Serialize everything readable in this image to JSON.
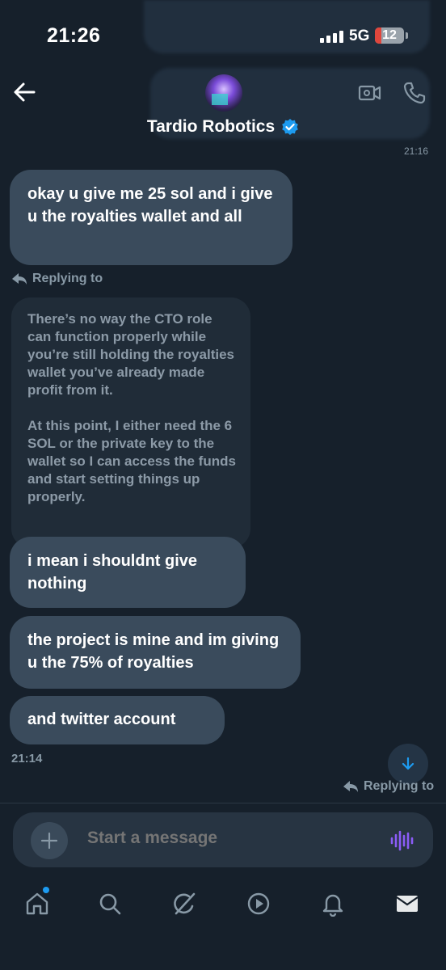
{
  "status_bar": {
    "time": "21:26",
    "network": "5G",
    "battery": "12"
  },
  "header": {
    "name": "Tardio Robotics",
    "partial_time": "21:16"
  },
  "messages": [
    {
      "text": "okay u give me  25 sol and i give u the royalties wallet and all"
    },
    {
      "text": "i mean i shouldnt give nothing"
    },
    {
      "text": "the project is mine and im giving u the 75% of royalties"
    },
    {
      "text": "and twitter account"
    }
  ],
  "reply": {
    "label": "Replying to",
    "quote": "There’s no way the CTO role can function properly while you’re still holding the royalties wallet you’ve already made profit from it.\n\nAt this point, I either need the 6 SOL or the private key to the wallet so I can access the funds and start setting things up properly."
  },
  "timestamp": "21:14",
  "composer": {
    "placeholder": "Start a message"
  },
  "colors": {
    "background": "#16202b",
    "bubble": "#3a4b5c",
    "accent": "#1d9bf0",
    "voice": "#8b5cf6"
  },
  "icons": [
    "back-arrow-icon",
    "video-icon",
    "phone-icon",
    "verified-icon",
    "plus-icon",
    "voice-icon",
    "home-icon",
    "search-icon",
    "grok-icon",
    "video-play-icon",
    "bell-icon",
    "mail-icon",
    "arrow-down-icon",
    "reply-arrow-icon"
  ]
}
